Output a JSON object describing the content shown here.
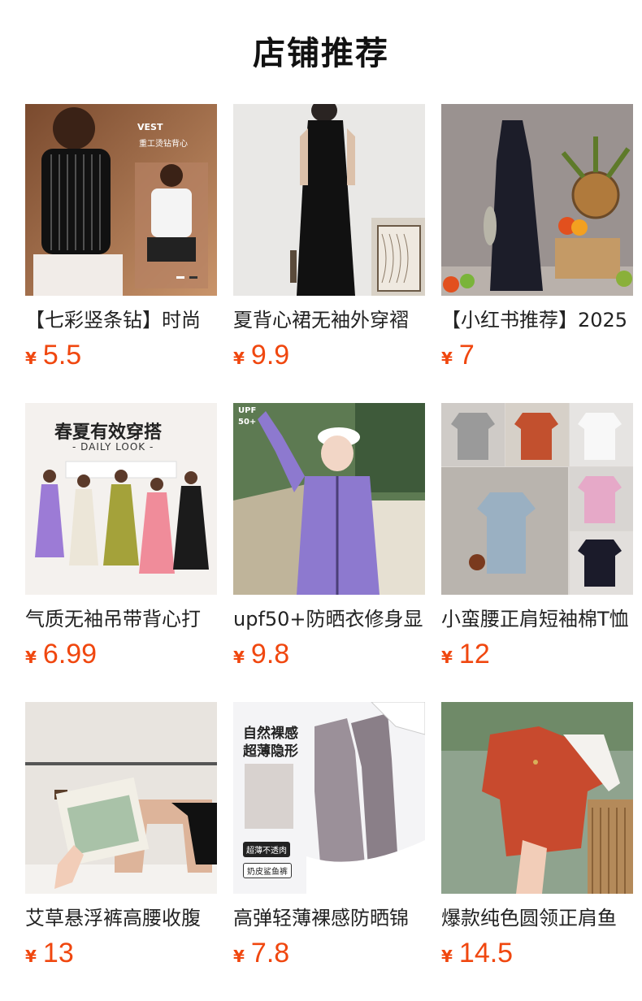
{
  "header": {
    "title": "店铺推荐"
  },
  "accent_color": "#f0470f",
  "products": [
    {
      "name": "【七彩竖条钻】时尚",
      "currency": "¥",
      "price": "5.5",
      "image_label_1": "VEST",
      "image_label_2": "重工烫钻背心"
    },
    {
      "name": "夏背心裙无袖外穿褶",
      "currency": "¥",
      "price": "9.9"
    },
    {
      "name": "【小红书推荐】2025",
      "currency": "¥",
      "price": "7"
    },
    {
      "name": "气质无袖吊带背心打",
      "currency": "¥",
      "price": "6.99",
      "image_label_1": "春夏有效穿搭",
      "image_label_2": "- DAILY LOOK -"
    },
    {
      "name": "upf50+防晒衣修身显",
      "currency": "¥",
      "price": "9.8",
      "image_label_1": "UPF",
      "image_label_2": "50+"
    },
    {
      "name": "小蛮腰正肩短袖棉T恤",
      "currency": "¥",
      "price": "12"
    },
    {
      "name": "艾草悬浮裤高腰收腹",
      "currency": "¥",
      "price": "13"
    },
    {
      "name": "高弹轻薄裸感防晒锦",
      "currency": "¥",
      "price": "7.8",
      "image_label_1": "自然裸感",
      "image_label_2": "超薄隐形",
      "image_label_3": "超薄不透肉",
      "image_label_4": "奶皮鲨鱼裤"
    },
    {
      "name": "爆款纯色圆领正肩鱼",
      "currency": "¥",
      "price": "14.5"
    }
  ]
}
